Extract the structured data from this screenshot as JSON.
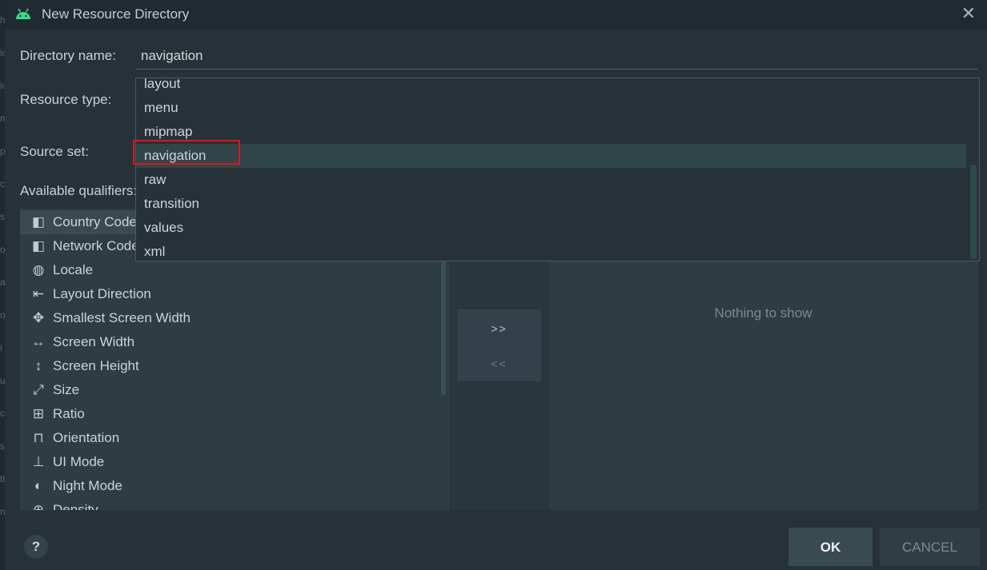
{
  "window": {
    "title": "New Resource Directory",
    "icon": "android-icon",
    "close_glyph": "✕"
  },
  "background_strip": [
    "h",
    "ic",
    "ic",
    "m",
    "p",
    "c",
    "s",
    "o",
    "a",
    "o",
    "i",
    "u",
    "c",
    "s",
    "tl",
    "n"
  ],
  "form": {
    "directory_name_label": "Directory name:",
    "directory_name_value": "navigation",
    "resource_type_label": "Resource type:",
    "source_set_label": "Source set:",
    "available_qualifiers_label": "Available qualifiers:"
  },
  "resource_type_dropdown": {
    "items": [
      "layout",
      "menu",
      "mipmap",
      "navigation",
      "raw",
      "transition",
      "values",
      "xml"
    ],
    "selected": "navigation"
  },
  "qualifiers": [
    {
      "label": "Country Code",
      "icon": "country-code-icon",
      "glyph": "◧"
    },
    {
      "label": "Network Code",
      "icon": "network-code-icon",
      "glyph": "◧"
    },
    {
      "label": "Locale",
      "icon": "globe-icon",
      "glyph": "◍"
    },
    {
      "label": "Layout Direction",
      "icon": "layout-direction-icon",
      "glyph": "⇤"
    },
    {
      "label": "Smallest Screen Width",
      "icon": "smallest-width-icon",
      "glyph": "✥"
    },
    {
      "label": "Screen Width",
      "icon": "screen-width-icon",
      "glyph": "↔"
    },
    {
      "label": "Screen Height",
      "icon": "screen-height-icon",
      "glyph": "↕"
    },
    {
      "label": "Size",
      "icon": "size-icon",
      "glyph": "⤢"
    },
    {
      "label": "Ratio",
      "icon": "ratio-icon",
      "glyph": "⊞"
    },
    {
      "label": "Orientation",
      "icon": "orientation-icon",
      "glyph": "⊓"
    },
    {
      "label": "UI Mode",
      "icon": "ui-mode-icon",
      "glyph": "⊥"
    },
    {
      "label": "Night Mode",
      "icon": "night-mode-icon",
      "glyph": "◐"
    },
    {
      "label": "Density",
      "icon": "density-icon",
      "glyph": "⊕"
    }
  ],
  "transfer": {
    "add_label": ">>",
    "remove_label": "<<"
  },
  "chosen_panel": {
    "empty_text": "Nothing to show"
  },
  "footer": {
    "help_label": "?",
    "ok_label": "OK",
    "cancel_label": "CANCEL"
  },
  "colors": {
    "background": "#263238",
    "selection": "#2f4548",
    "highlight": "#e0151b",
    "android_green": "#3ddc84"
  }
}
